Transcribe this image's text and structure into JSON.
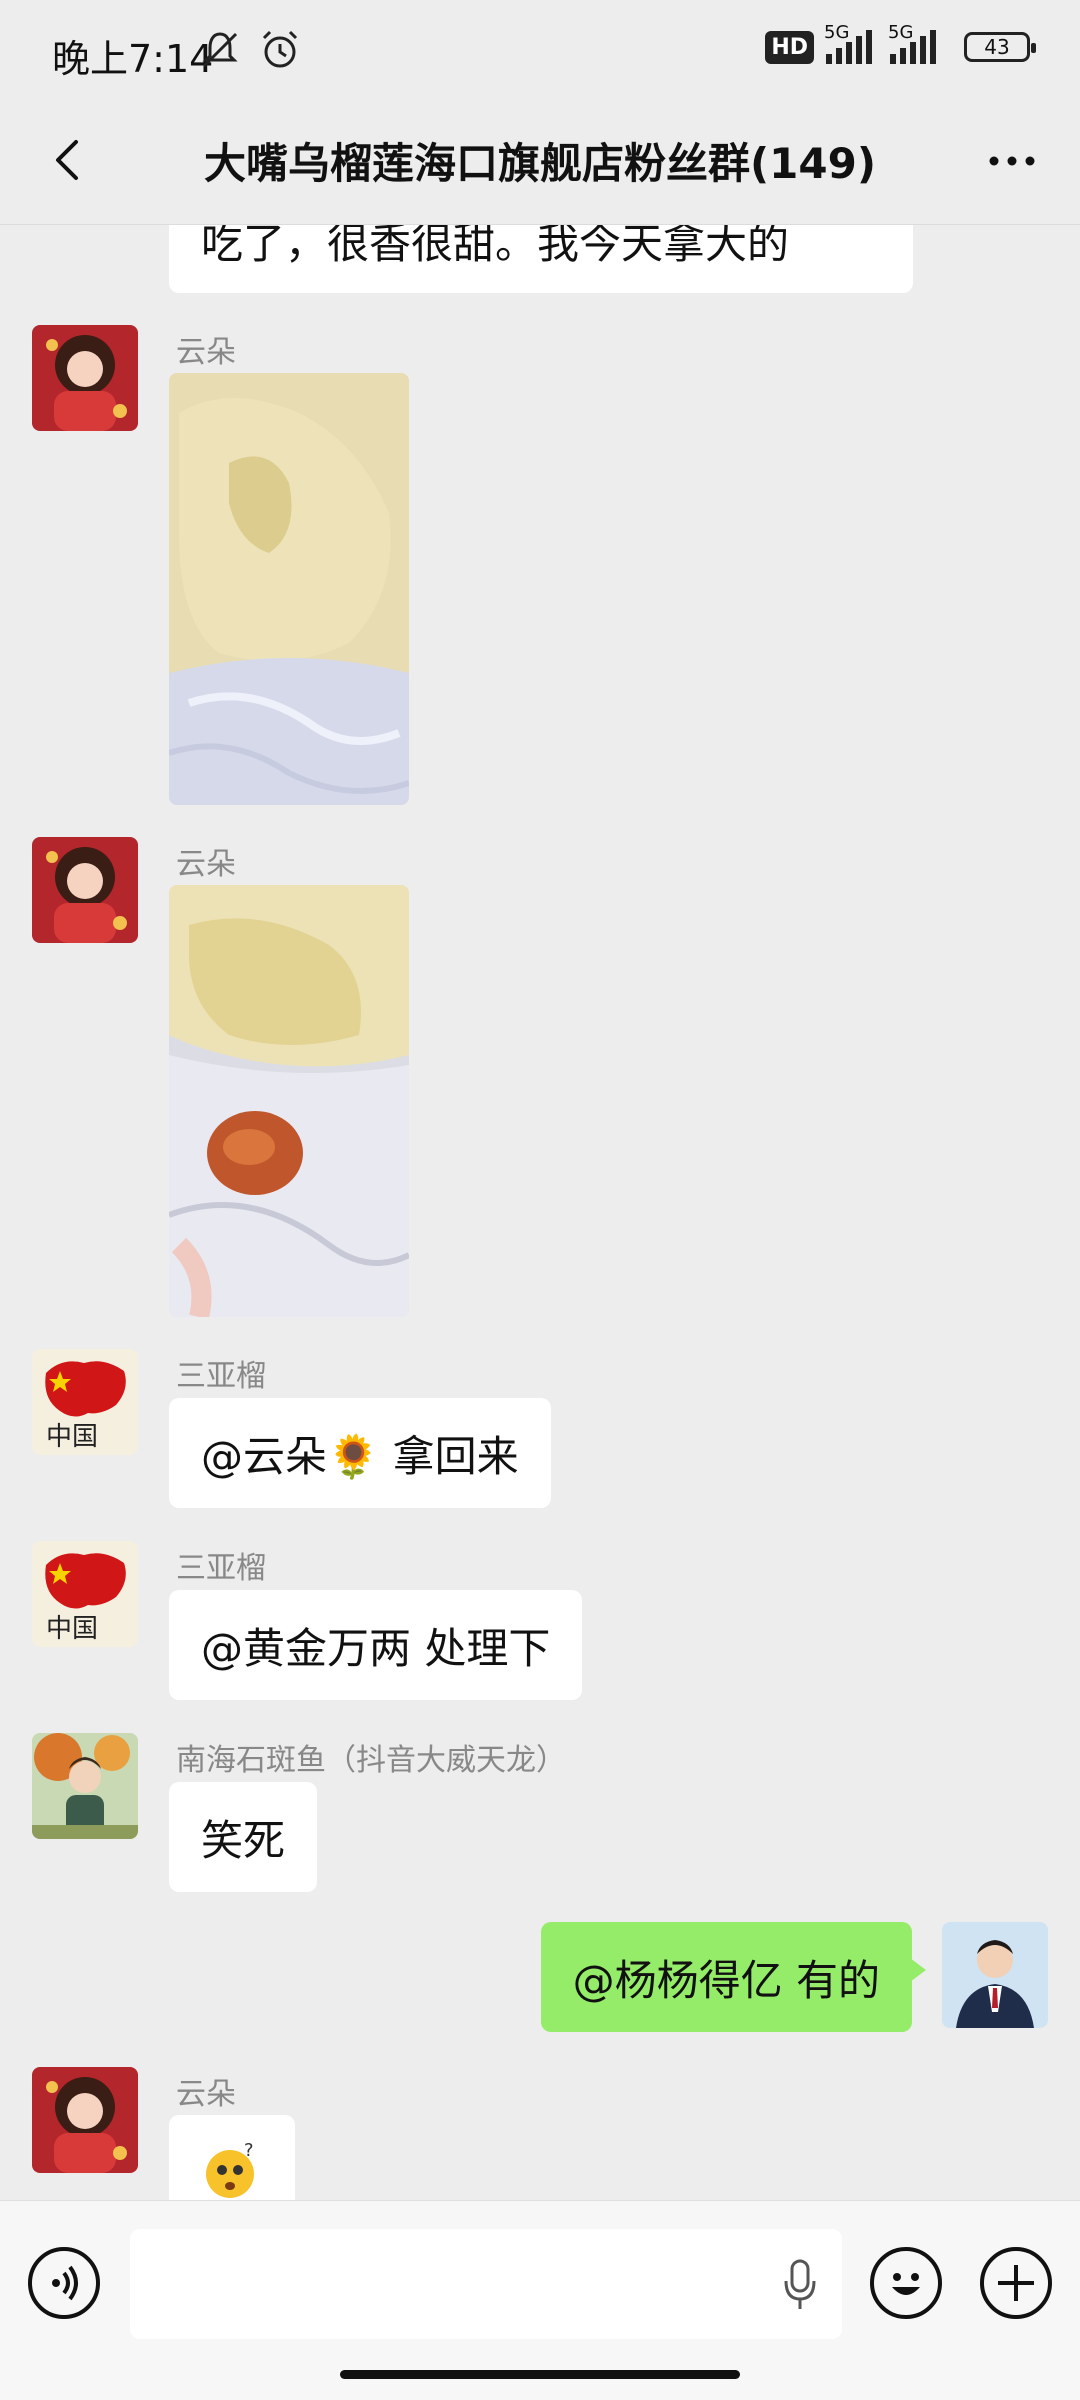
{
  "status_bar": {
    "time": "晚上7:14",
    "hd_badge": "HD",
    "signal1_label": "5G",
    "signal2_label": "5G",
    "battery": "43"
  },
  "header": {
    "title": "大嘴乌榴莲海口旗舰店粉丝群(149)"
  },
  "messages": [
    {
      "type": "text",
      "text": "吃了，很香很甜。我今天拿大的"
    },
    {
      "type": "image",
      "sender": "云朵"
    },
    {
      "type": "image",
      "sender": "云朵"
    },
    {
      "type": "text",
      "sender": "三亚榴",
      "text": "@云朵🌻  拿回来"
    },
    {
      "type": "text",
      "sender": "三亚榴",
      "text": "@黄金万两  处理下"
    },
    {
      "type": "text",
      "sender": "南海石斑鱼（抖音大威天龙）",
      "text": "笑死"
    },
    {
      "type": "text",
      "mine": true,
      "text": "@杨杨得亿  有的"
    },
    {
      "type": "emoji",
      "sender": "云朵",
      "text": "😳❓"
    }
  ],
  "avatar_labels": {
    "sanya": "中国"
  },
  "colors": {
    "background": "#ededed",
    "my_bubble": "#95ec69",
    "other_bubble": "#ffffff"
  }
}
